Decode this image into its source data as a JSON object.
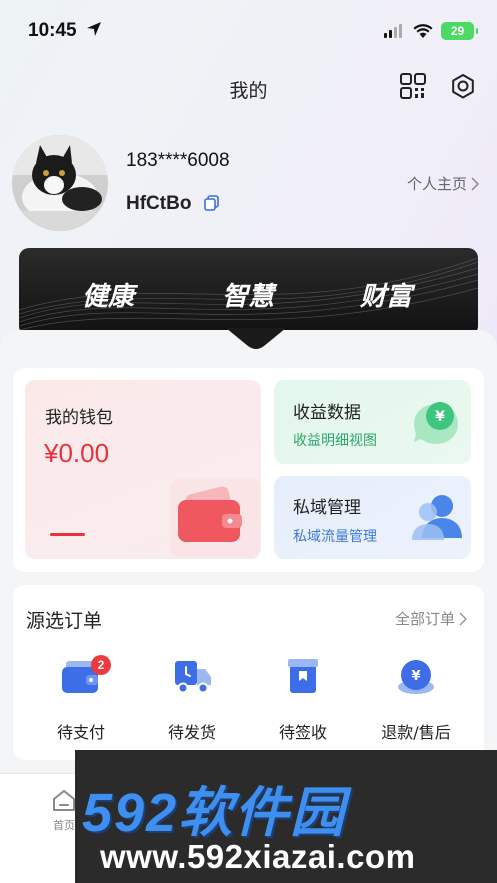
{
  "status_bar": {
    "time": "10:45",
    "battery": "29"
  },
  "header": {
    "title": "我的"
  },
  "profile": {
    "phone": "183****6008",
    "nickname": "HfCtBo",
    "homepage_link": "个人主页"
  },
  "banner": {
    "words": [
      "健康",
      "智慧",
      "财富"
    ]
  },
  "assets": {
    "wallet": {
      "title": "我的钱包",
      "amount": "¥0.00"
    },
    "income": {
      "title": "收益数据",
      "subtitle": "收益明细视图"
    },
    "private_domain": {
      "title": "私域管理",
      "subtitle": "私域流量管理"
    }
  },
  "orders": {
    "title": "源选订单",
    "all_link": "全部订单",
    "items": [
      {
        "label": "待支付",
        "badge": "2",
        "icon": "wallet-icon"
      },
      {
        "label": "待发货",
        "icon": "delivery-truck-icon"
      },
      {
        "label": "待签收",
        "icon": "package-icon"
      },
      {
        "label": "退款/售后",
        "icon": "refund-coin-icon"
      }
    ]
  },
  "tabbar": {
    "home_label": "首页"
  },
  "watermark": {
    "brand": "592软件园",
    "url": "www.592xiazai.com"
  },
  "colors": {
    "accent_red": "#e8323c",
    "income_green": "#2aa866",
    "private_blue": "#3e7ad8",
    "order_icon_blue": "#3d6ee8"
  }
}
